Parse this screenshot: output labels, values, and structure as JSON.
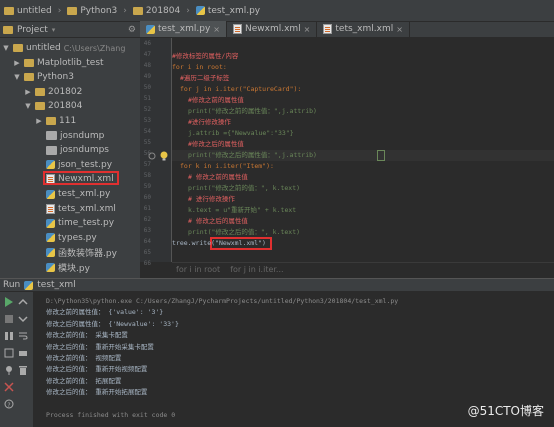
{
  "breadcrumb": {
    "items": [
      "untitled",
      "Python3",
      "201804",
      "test_xml.py"
    ]
  },
  "project_panel": {
    "header_label": "Project",
    "tree": [
      {
        "label": "untitled",
        "path": "C:\\Users\\Zhang",
        "level": 0,
        "expanded": true,
        "kind": "folder"
      },
      {
        "label": "Matplotlib_test",
        "level": 1,
        "expanded": false,
        "kind": "folder"
      },
      {
        "label": "Python3",
        "level": 1,
        "expanded": true,
        "kind": "folder"
      },
      {
        "label": "201802",
        "level": 2,
        "expanded": false,
        "kind": "folder"
      },
      {
        "label": "201804",
        "level": 2,
        "expanded": true,
        "kind": "folder"
      },
      {
        "label": "111",
        "level": 3,
        "expanded": false,
        "kind": "folder"
      },
      {
        "label": "josndump",
        "level": 3,
        "kind": "file"
      },
      {
        "label": "josndumps",
        "level": 3,
        "kind": "file"
      },
      {
        "label": "json_test.py",
        "level": 3,
        "kind": "py"
      },
      {
        "label": "Newxml.xml",
        "level": 3,
        "kind": "xml",
        "highlighted": true
      },
      {
        "label": "test_xml.py",
        "level": 3,
        "kind": "py"
      },
      {
        "label": "tets_xml.xml",
        "level": 3,
        "kind": "xml"
      },
      {
        "label": "time_test.py",
        "level": 3,
        "kind": "py"
      },
      {
        "label": "types.py",
        "level": 3,
        "kind": "py"
      },
      {
        "label": "函数装饰器.py",
        "level": 3,
        "kind": "py"
      },
      {
        "label": "模块.py",
        "level": 3,
        "kind": "py"
      }
    ]
  },
  "editor_tabs": [
    {
      "label": "test_xml.py",
      "kind": "py",
      "active": true
    },
    {
      "label": "Newxml.xml",
      "kind": "xml",
      "active": false
    },
    {
      "label": "tets_xml.xml",
      "kind": "xml",
      "active": false
    }
  ],
  "line_numbers": [
    "46",
    "47",
    "48",
    "49",
    "50",
    "51",
    "52",
    "53",
    "54",
    "55",
    "56",
    "57",
    "58",
    "59",
    "60",
    "61",
    "62",
    "63",
    "64",
    "65",
    "66"
  ],
  "code_lines": [
    {
      "indent": 2,
      "text": "#修改标签的属性/内容",
      "cls": "cmt"
    },
    {
      "indent": 2,
      "text": "for i in root:",
      "cls": "kw"
    },
    {
      "indent": 3,
      "text": "#遍历二级子标签",
      "cls": "cmt"
    },
    {
      "indent": 3,
      "text": "for j in i.iter(\"CaptureCard\"):",
      "cls": "kw"
    },
    {
      "indent": 4,
      "text": "#修改之前的属性值",
      "cls": "cmt"
    },
    {
      "indent": 4,
      "text": "print(\"修改之前的属性值：\",j.attrib)",
      "cls": "str"
    },
    {
      "indent": 4,
      "text": "#进行修改操作",
      "cls": "cmt"
    },
    {
      "indent": 4,
      "text": "j.attrib ={\"Newvalue\":\"33\"}",
      "cls": "str"
    },
    {
      "indent": 4,
      "text": "#修改之后的属性值",
      "cls": "cmt"
    },
    {
      "indent": 4,
      "text": "print(\"修改之后的属性值：\",j.attrib)",
      "cls": "str"
    },
    {
      "indent": 3,
      "text": "for k in i.iter(\"Item\"):",
      "cls": "kw"
    },
    {
      "indent": 4,
      "text": "# 修改之前的属性值",
      "cls": "cmt"
    },
    {
      "indent": 4,
      "text": "print(\"修改之前的值：\", k.text)",
      "cls": "str"
    },
    {
      "indent": 4,
      "text": "# 进行修改操作",
      "cls": "cmt"
    },
    {
      "indent": 4,
      "text": "k.text = u\"重新开始\" + k.text",
      "cls": "str"
    },
    {
      "indent": 4,
      "text": "# 修改之后的属性值",
      "cls": "cmt"
    },
    {
      "indent": 4,
      "text": "print(\"修改之后的值：\", k.text)",
      "cls": "str"
    },
    {
      "indent": 2,
      "text": "tree.write(\"Newxml.xml\")",
      "cls": "fn"
    }
  ],
  "editor_breadcrumb": [
    "for i in root",
    "for j in i.iter..."
  ],
  "run_panel": {
    "label": "Run",
    "config": "test_xml",
    "console_lines": [
      {
        "text": "D:\\Python35\\python.exe C:/Users/ZhangJ/PycharmProjects/untitled/Python3/201804/test_xml.py",
        "gray": true
      },
      {
        "text": "修改之前的属性值： {'value': '3'}",
        "gray": false
      },
      {
        "text": "修改之后的属性值： {'Newvalue': '33'}",
        "gray": false
      },
      {
        "text": "修改之前的值： 采集卡配置",
        "gray": false
      },
      {
        "text": "修改之后的值： 重新开始采集卡配置",
        "gray": false
      },
      {
        "text": "修改之前的值： 视频配置",
        "gray": false
      },
      {
        "text": "修改之后的值： 重新开始视频配置",
        "gray": false
      },
      {
        "text": "修改之前的值： 拓展配置",
        "gray": false
      },
      {
        "text": "修改之后的值： 重新开始拓展配置",
        "gray": false
      },
      {
        "text": "",
        "gray": false
      },
      {
        "text": "Process finished with exit code 0",
        "gray": true
      }
    ]
  },
  "watermark": "@51CTO博客",
  "colors": {
    "accent_red": "#e03030",
    "keyword": "#cc7832",
    "comment_red": "#e06060",
    "string": "#6a8759"
  }
}
